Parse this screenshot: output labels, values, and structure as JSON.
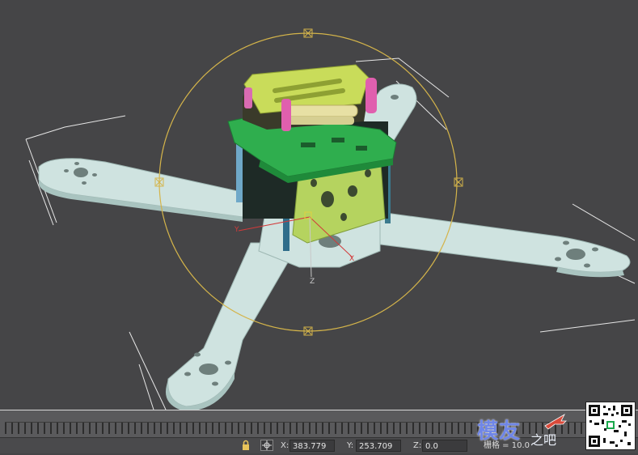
{
  "viewport": {
    "axis_labels": {
      "x": "X",
      "y": "Y",
      "z": "Z"
    },
    "gizmo_box_marker": "×"
  },
  "statusbar": {
    "lock_icon": "lock-icon",
    "transform_icon": "absolute-mode-icon",
    "x_label": "X:",
    "x_value": "383.779",
    "y_label": "Y:",
    "y_value": "253.709",
    "z_label": "Z:",
    "z_value": "0.0",
    "grid_text": "栅格 = 10.0"
  },
  "watermark": {
    "text": "模友",
    "sub": "之吧"
  },
  "colors": {
    "frame": "#cfe3e0",
    "gizmo": "#d4b44a",
    "pcb": "#2fae4e",
    "battery_tray": "#c9dc5a",
    "side_plate": "#b5d35f",
    "accent": "#e05fae"
  }
}
